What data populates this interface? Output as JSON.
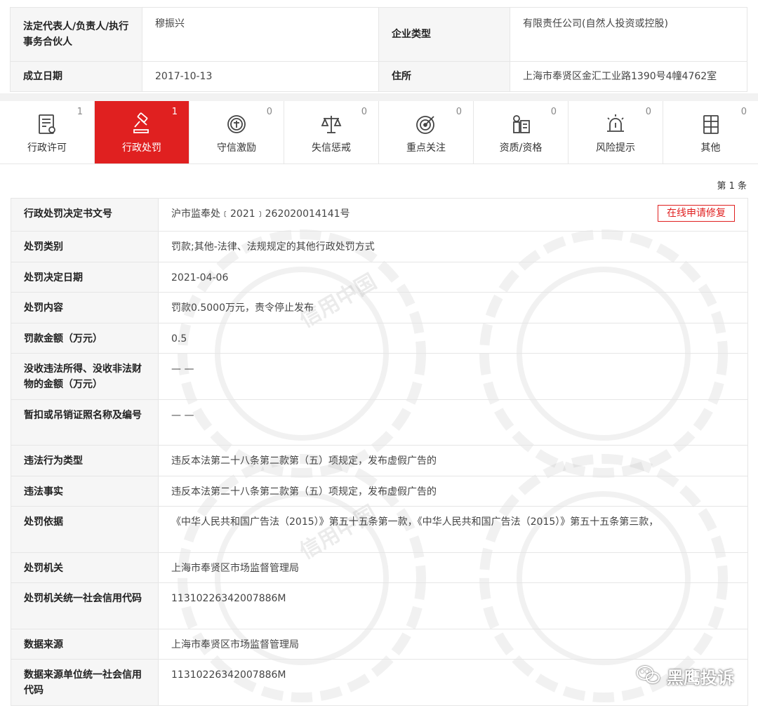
{
  "company": {
    "rep_label": "法定代表人/负责人/执行事务合伙人",
    "rep_value": "穆振兴",
    "type_label": "企业类型",
    "type_value": "有限责任公司(自然人投资或控股)",
    "founded_label": "成立日期",
    "founded_value": "2017-10-13",
    "address_label": "住所",
    "address_value": "上海市奉贤区金汇工业路1390号4幢4762室"
  },
  "tabs": [
    {
      "label": "行政许可",
      "count": "1",
      "icon": "document-seal-icon"
    },
    {
      "label": "行政处罚",
      "count": "1",
      "icon": "gavel-icon",
      "active": true
    },
    {
      "label": "守信激励",
      "count": "0",
      "icon": "credit-badge-icon"
    },
    {
      "label": "失信惩戒",
      "count": "0",
      "icon": "scales-icon"
    },
    {
      "label": "重点关注",
      "count": "0",
      "icon": "target-icon"
    },
    {
      "label": "资质/资格",
      "count": "0",
      "icon": "certificate-icon"
    },
    {
      "label": "风险提示",
      "count": "0",
      "icon": "alarm-icon"
    },
    {
      "label": "其他",
      "count": "0",
      "icon": "grid-doc-icon"
    }
  ],
  "page_counter": "第 1 条",
  "repair_button": "在线申请修复",
  "rows": [
    {
      "label": "行政处罚决定书文号",
      "value": "沪市监奉处﹝2021﹞262020014141号"
    },
    {
      "label": "处罚类别",
      "value": "罚款;其他-法律、法规规定的其他行政处罚方式"
    },
    {
      "label": "处罚决定日期",
      "value": "2021-04-06"
    },
    {
      "label": "处罚内容",
      "value": "罚款0.5000万元，责令停止发布"
    },
    {
      "label": "罚款金额（万元）",
      "value": "0.5"
    },
    {
      "label": "没收违法所得、没收非法财物的金额（万元）",
      "value": "— —"
    },
    {
      "label": "暂扣或吊销证照名称及编号",
      "value": "— —"
    },
    {
      "label": "违法行为类型",
      "value": "违反本法第二十八条第二款第（五）项规定，发布虚假广告的"
    },
    {
      "label": "违法事实",
      "value": "违反本法第二十八条第二款第（五）项规定，发布虚假广告的"
    },
    {
      "label": "处罚依据",
      "value": "《中华人民共和国广告法（2015）》第五十五条第一款，《中华人民共和国广告法（2015）》第五十五条第三款，"
    },
    {
      "label": "处罚机关",
      "value": "上海市奉贤区市场监督管理局"
    },
    {
      "label": "处罚机关统一社会信用代码",
      "value": "11310226342007886M"
    },
    {
      "label": "数据来源",
      "value": "上海市奉贤区市场监督管理局"
    },
    {
      "label": "数据来源单位统一社会信用代码",
      "value": "11310226342007886M"
    }
  ],
  "watermark_text": "信用中国",
  "brand_text": "黑鹰投诉",
  "colors": {
    "accent": "#e02020",
    "label_bg": "#f6f6f6",
    "border": "#e6e6e6"
  }
}
